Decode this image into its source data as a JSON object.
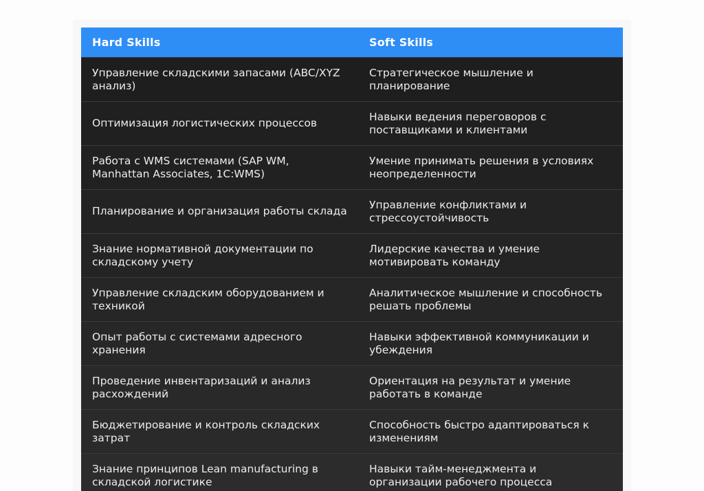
{
  "table": {
    "headers": [
      "Hard Skills",
      "Soft Skills"
    ],
    "rows": [
      [
        "Управление складскими запасами (ABC/XYZ анализ)",
        "Стратегическое мышление и планирование"
      ],
      [
        "Оптимизация логистических процессов",
        "Навыки ведения переговоров с поставщиками и клиентами"
      ],
      [
        "Работа с WMS системами (SAP WM, Manhattan Associates, 1С:WMS)",
        "Умение принимать решения в условиях неопределенности"
      ],
      [
        "Планирование и организация работы склада",
        "Управление конфликтами и стрессоустойчивость"
      ],
      [
        "Знание нормативной документации по складскому учету",
        "Лидерские качества и умение мотивировать команду"
      ],
      [
        "Управление складским оборудованием и техникой",
        "Аналитическое мышление и способность решать проблемы"
      ],
      [
        "Опыт работы с системами адресного хранения",
        "Навыки эффективной коммуникации и убеждения"
      ],
      [
        "Проведение инвентаризаций и анализ расхождений",
        "Ориентация на результат и умение работать в команде"
      ],
      [
        "Бюджетирование и контроль складских затрат",
        "Способность быстро адаптироваться к изменениям"
      ],
      [
        "Знание принципов Lean manufacturing в складской логистике",
        "Навыки тайм-менеджмента и организации рабочего процесса"
      ]
    ]
  },
  "colors": {
    "header_bg": "#2f8df6",
    "row_bg": "#242424",
    "text": "#ececec"
  }
}
